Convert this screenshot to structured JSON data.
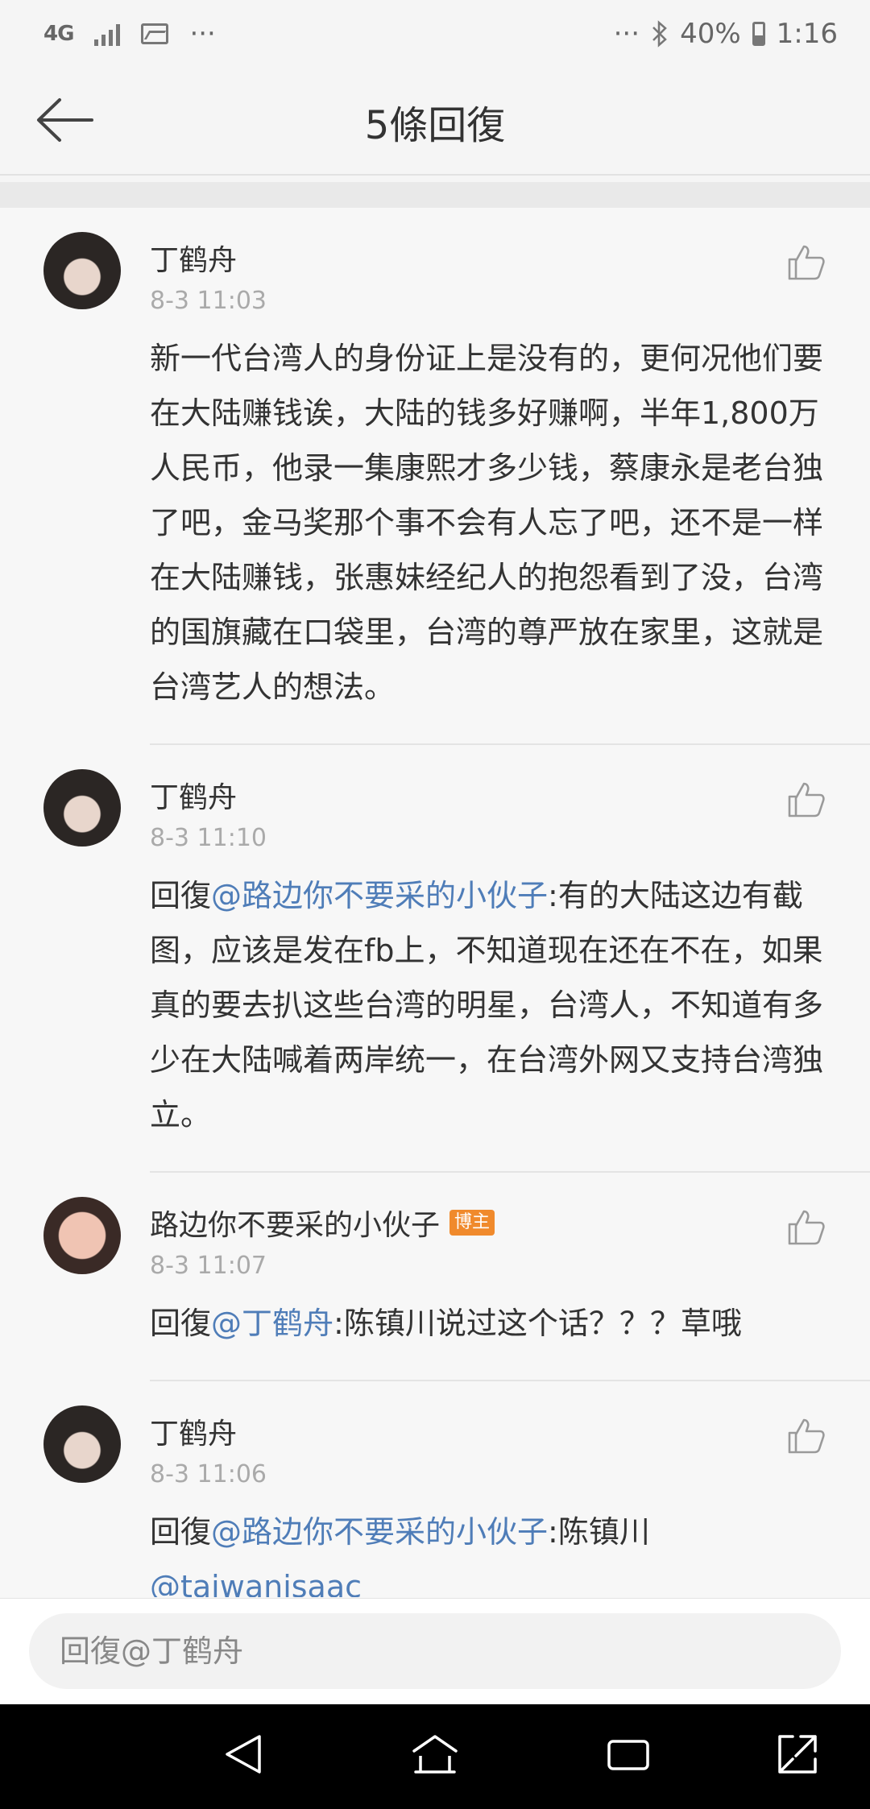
{
  "status_bar": {
    "network": "4G",
    "overflow_left": "···",
    "overflow_right": "···",
    "battery_percent": "40%",
    "time": "1:16"
  },
  "header": {
    "title": "5條回復"
  },
  "replies": [
    {
      "username": "丁鹤舟",
      "timestamp": "8-3 11:03",
      "prefix": "",
      "mention": "",
      "text": "新一代台湾人的身份证上是没有的，更何况他们要在大陆赚钱诶，大陆的钱多好赚啊，半年1,800万人民币，他录一集康熙才多少钱，蔡康永是老台独了吧，金马奖那个事不会有人忘了吧，还不是一样在大陆赚钱，张惠妹经纪人的抱怨看到了没，台湾的国旗藏在口袋里，台湾的尊严放在家里，这就是台湾艺人的想法。",
      "mention2": "",
      "badge": ""
    },
    {
      "username": "丁鹤舟",
      "timestamp": "8-3 11:10",
      "prefix": "回復",
      "mention": "@路边你不要采的小伙子",
      "text": ":有的大陆这边有截图，应该是发在fb上，不知道现在还在不在，如果真的要去扒这些台湾的明星，台湾人，不知道有多少在大陆喊着两岸统一，在台湾外网又支持台湾独立。",
      "mention2": "",
      "badge": ""
    },
    {
      "username": "路边你不要采的小伙子",
      "timestamp": "8-3 11:07",
      "prefix": "回復",
      "mention": "@丁鹤舟",
      "text": ":陈镇川说过这个话？？？草哦",
      "mention2": "",
      "badge": "博主"
    },
    {
      "username": "丁鹤舟",
      "timestamp": "8-3 11:06",
      "prefix": "回復",
      "mention": "@路边你不要采的小伙子",
      "text": ":陈镇川",
      "mention2": "@taiwanisaac",
      "badge": ""
    }
  ],
  "reply_input": {
    "placeholder": "回復@丁鹤舟"
  },
  "icons": {
    "back": "back-arrow-icon",
    "like": "thumbs-up-icon",
    "nav_back": "triangle-back-icon",
    "nav_home": "home-icon",
    "nav_recents": "recents-icon",
    "nav_expand": "expand-icon"
  },
  "colors": {
    "mention": "#4f7db8",
    "badge": "#f08a2c",
    "timestamp": "#aaaaaa"
  }
}
